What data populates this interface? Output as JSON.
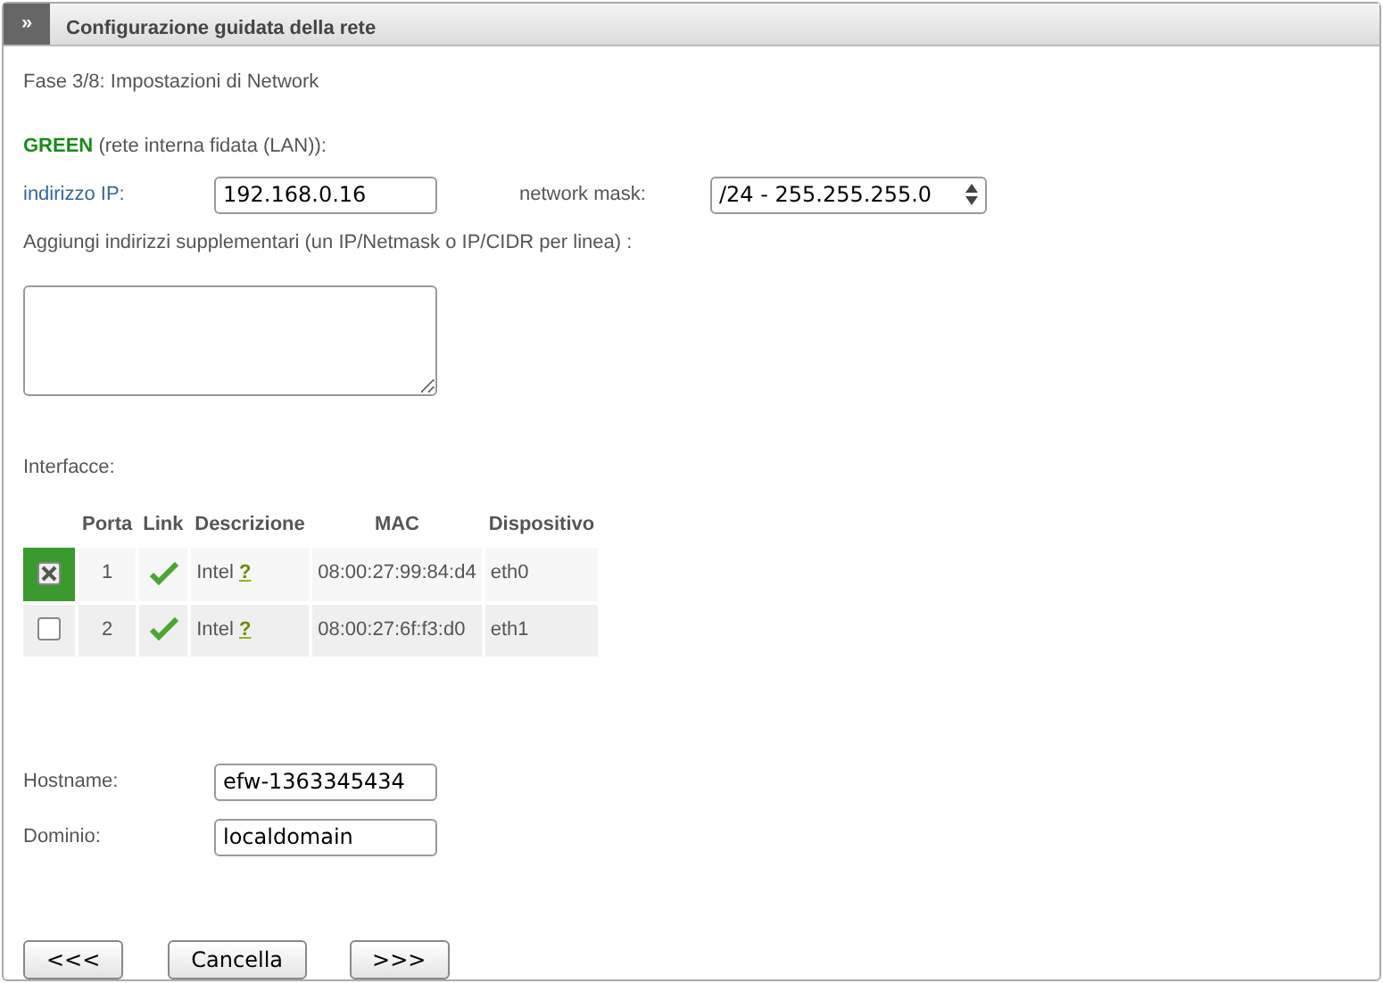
{
  "header": {
    "toggle": "»",
    "title": "Configurazione guidata della rete"
  },
  "step": "Fase 3/8: Impostazioni di Network",
  "zone": {
    "name": "GREEN",
    "description": "(rete interna fidata (LAN)):"
  },
  "ip": {
    "label": "indirizzo IP:",
    "value": "192.168.0.16"
  },
  "netmask": {
    "label": "network mask:",
    "value": "/24 - 255.255.255.0"
  },
  "extra": {
    "label": "Aggiungi indirizzi supplementari (un IP/Netmask o IP/CIDR per linea) :"
  },
  "interfaces": {
    "label": "Interfacce:",
    "columns": [
      "Porta",
      "Link",
      "Descrizione",
      "MAC",
      "Dispositivo"
    ],
    "rows": [
      {
        "checked": true,
        "port": "1",
        "link": true,
        "description": "Intel",
        "help": "?",
        "mac": "08:00:27:99:84:d4",
        "device": "eth0"
      },
      {
        "checked": false,
        "port": "2",
        "link": true,
        "description": "Intel",
        "help": "?",
        "mac": "08:00:27:6f:f3:d0",
        "device": "eth1"
      }
    ]
  },
  "hostname": {
    "label": "Hostname:",
    "value": "efw-1363345434"
  },
  "domain": {
    "label": "Dominio:",
    "value": "localdomain"
  },
  "buttons": [
    "<<<",
    "Cancella",
    ">>>"
  ]
}
